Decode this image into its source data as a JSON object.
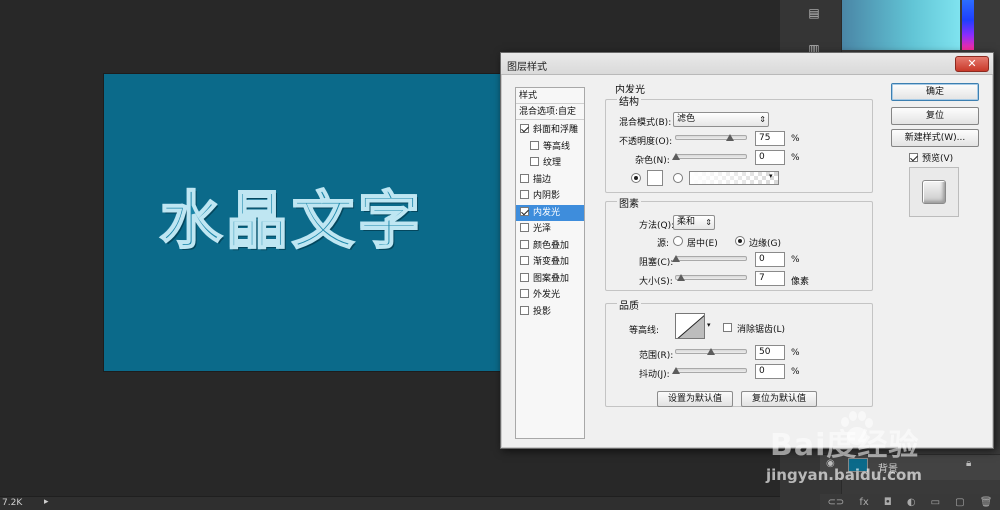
{
  "canvas": {
    "art_text": "水晶文字"
  },
  "status": {
    "zoom": "7.2K",
    "arrow": "▸"
  },
  "layers": {
    "layer_name": "背景"
  },
  "watermark": {
    "logo": "Bai度经验",
    "url": "jingyan.baidu.com"
  },
  "dialog": {
    "title": "图层样式",
    "close": "✕",
    "style_list": {
      "header": "样式",
      "blend_options": "混合选项:自定",
      "items": [
        {
          "label": "斜面和浮雕",
          "checked": true,
          "indent": false
        },
        {
          "label": "等高线",
          "checked": false,
          "indent": true
        },
        {
          "label": "纹理",
          "checked": false,
          "indent": true
        },
        {
          "label": "描边",
          "checked": false,
          "indent": false
        },
        {
          "label": "内阴影",
          "checked": false,
          "indent": false
        },
        {
          "label": "内发光",
          "checked": true,
          "indent": false,
          "selected": true
        },
        {
          "label": "光泽",
          "checked": false,
          "indent": false
        },
        {
          "label": "颜色叠加",
          "checked": false,
          "indent": false
        },
        {
          "label": "渐变叠加",
          "checked": false,
          "indent": false
        },
        {
          "label": "图案叠加",
          "checked": false,
          "indent": false
        },
        {
          "label": "外发光",
          "checked": false,
          "indent": false
        },
        {
          "label": "投影",
          "checked": false,
          "indent": false
        }
      ]
    },
    "inner_glow": {
      "section_title": "内发光",
      "structure": {
        "title": "结构",
        "blend_mode_label": "混合模式(B):",
        "blend_mode_value": "滤色",
        "opacity_label": "不透明度(O):",
        "opacity_value": "75",
        "opacity_unit": "%",
        "noise_label": "杂色(N):",
        "noise_value": "0",
        "noise_unit": "%"
      },
      "elements": {
        "title": "图素",
        "method_label": "方法(Q):",
        "method_value": "柔和",
        "source_label": "源:",
        "source_center": "居中(E)",
        "source_edge": "边缘(G)",
        "choke_label": "阻塞(C):",
        "choke_value": "0",
        "choke_unit": "%",
        "size_label": "大小(S):",
        "size_value": "7",
        "size_unit": "像素"
      },
      "quality": {
        "title": "品质",
        "contour_label": "等高线:",
        "antialias_label": "消除锯齿(L)",
        "range_label": "范围(R):",
        "range_value": "50",
        "range_unit": "%",
        "jitter_label": "抖动(J):",
        "jitter_value": "0",
        "jitter_unit": "%"
      },
      "set_default": "设置为默认值",
      "reset_default": "复位为默认值"
    },
    "side": {
      "ok": "确定",
      "reset": "复位",
      "new_style": "新建样式(W)...",
      "preview_label": "预览(V)"
    }
  }
}
